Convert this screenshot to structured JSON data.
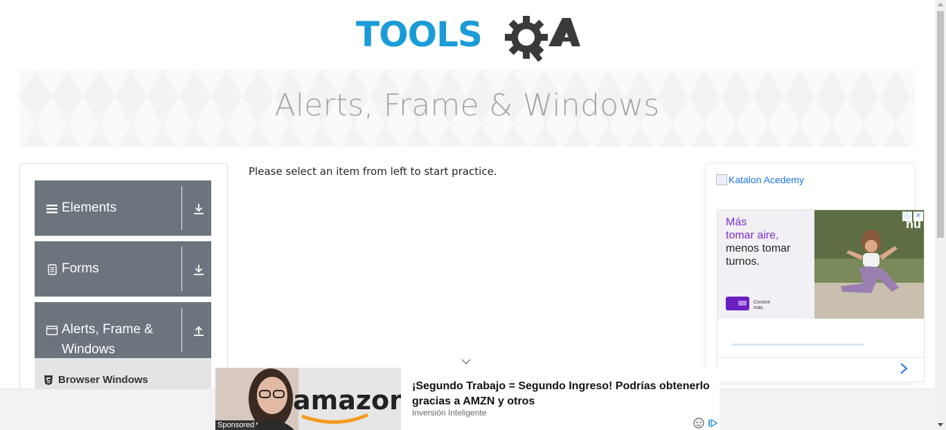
{
  "logo": {
    "text_part": "TOOLS",
    "qa_part": "QA",
    "colors": {
      "tools": "#1b9bd7",
      "qa": "#3a3a3a"
    }
  },
  "banner": {
    "title": "Alerts, Frame & Windows"
  },
  "sidebar": {
    "groups": [
      {
        "label": "Elements",
        "icon": "hamburger-icon",
        "toggle_icon": "download-arrow-icon"
      },
      {
        "label": "Forms",
        "icon": "document-icon",
        "toggle_icon": "download-arrow-icon"
      },
      {
        "label": "Alerts, Frame &",
        "label_line2": "Windows",
        "icon": "window-icon",
        "toggle_icon": "upload-arrow-icon",
        "expanded": true
      }
    ],
    "sub_items": [
      {
        "label": "Browser Windows",
        "icon": "html5-icon"
      }
    ],
    "colors": {
      "group_bg": "#6c757d",
      "sub_bg": "#e4e4e4"
    }
  },
  "main": {
    "message": "Please select an item from left to start practice."
  },
  "right_ad": {
    "image_alt": "Katalon Acedemy",
    "ad": {
      "line1": "Más",
      "line2": "tomar aire,",
      "line3": "menos tomar",
      "line4": "turnos.",
      "cta": "Conoce",
      "cta2": "más.",
      "brand": "nu",
      "accent": "#7b2fd0"
    }
  },
  "bottom_ad": {
    "sponsored": "Sponsored",
    "headline": "¡Segundo Trabajo = Segundo Ingreso! Podrías obtenerlo gracias a AMZN y otros",
    "source": "Inversión Inteligente",
    "image_word": "amazon"
  }
}
